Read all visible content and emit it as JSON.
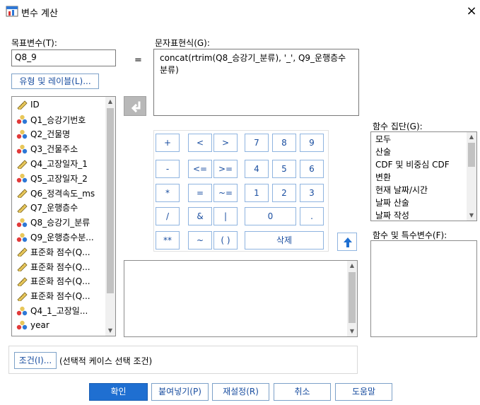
{
  "window": {
    "title": "변수 계산",
    "close_icon": "×"
  },
  "target": {
    "label": "목표변수(T):",
    "value": "Q8_9",
    "type_label_button": "유형 및 레이블(L)..."
  },
  "equals": "=",
  "expression": {
    "label": "문자표현식(G):",
    "value": "concat(rtrim(Q8_승강기_분류), '_', Q9_운행층수분류)"
  },
  "variables": [
    {
      "name": "ID",
      "icon": "ruler-icon"
    },
    {
      "name": "Q1_승강기번호",
      "icon": "nominal-icon"
    },
    {
      "name": "Q2_건물명",
      "icon": "nominal-icon"
    },
    {
      "name": "Q3_건물주소",
      "icon": "nominal-icon"
    },
    {
      "name": "Q4_고장일자_1",
      "icon": "ruler-icon"
    },
    {
      "name": "Q5_고장일자_2",
      "icon": "nominal-icon"
    },
    {
      "name": "Q6_정격속도_ms",
      "icon": "ruler-icon"
    },
    {
      "name": "Q7_운행층수",
      "icon": "ruler-icon"
    },
    {
      "name": "Q8_승강기_분류",
      "icon": "nominal-icon"
    },
    {
      "name": "Q9_운행층수분...",
      "icon": "nominal-icon"
    },
    {
      "name": "표준화 점수(Q...",
      "icon": "ruler-icon"
    },
    {
      "name": "표준화 점수(Q...",
      "icon": "ruler-icon"
    },
    {
      "name": "표준화 점수(Q...",
      "icon": "ruler-icon"
    },
    {
      "name": "표준화 점수(Q...",
      "icon": "ruler-icon"
    },
    {
      "name": "Q4_1_고장일...",
      "icon": "nominal-icon"
    },
    {
      "name": "year",
      "icon": "nominal-icon"
    }
  ],
  "keypad": {
    "row1": [
      "+",
      "<",
      ">",
      "7",
      "8",
      "9"
    ],
    "row2": [
      "-",
      "<=",
      ">=",
      "4",
      "5",
      "6"
    ],
    "row3": [
      "*",
      "=",
      "~=",
      "1",
      "2",
      "3"
    ],
    "row4": [
      "/",
      "&",
      "|",
      "0",
      "."
    ],
    "row5": [
      "**",
      "~",
      "( )",
      "삭제"
    ]
  },
  "function_group": {
    "label": "함수 집단(G):",
    "items": [
      "모두",
      "산술",
      "CDF 및 비중심 CDF",
      "변환",
      "현재 날짜/시간",
      "날짜 산술",
      "날짜 작성"
    ]
  },
  "functions_label": "함수 및 특수변수(F):",
  "condition": {
    "button": "조건(I)...",
    "text": "(선택적 케이스 선택 조건)"
  },
  "footer": {
    "ok": "확인",
    "paste": "붙여넣기(P)",
    "reset": "재설정(R)",
    "cancel": "취소",
    "help": "도움말"
  },
  "colors": {
    "accent": "#1f6fd1",
    "button_text": "#1a4ea0",
    "button_border": "#8fb4e0"
  }
}
